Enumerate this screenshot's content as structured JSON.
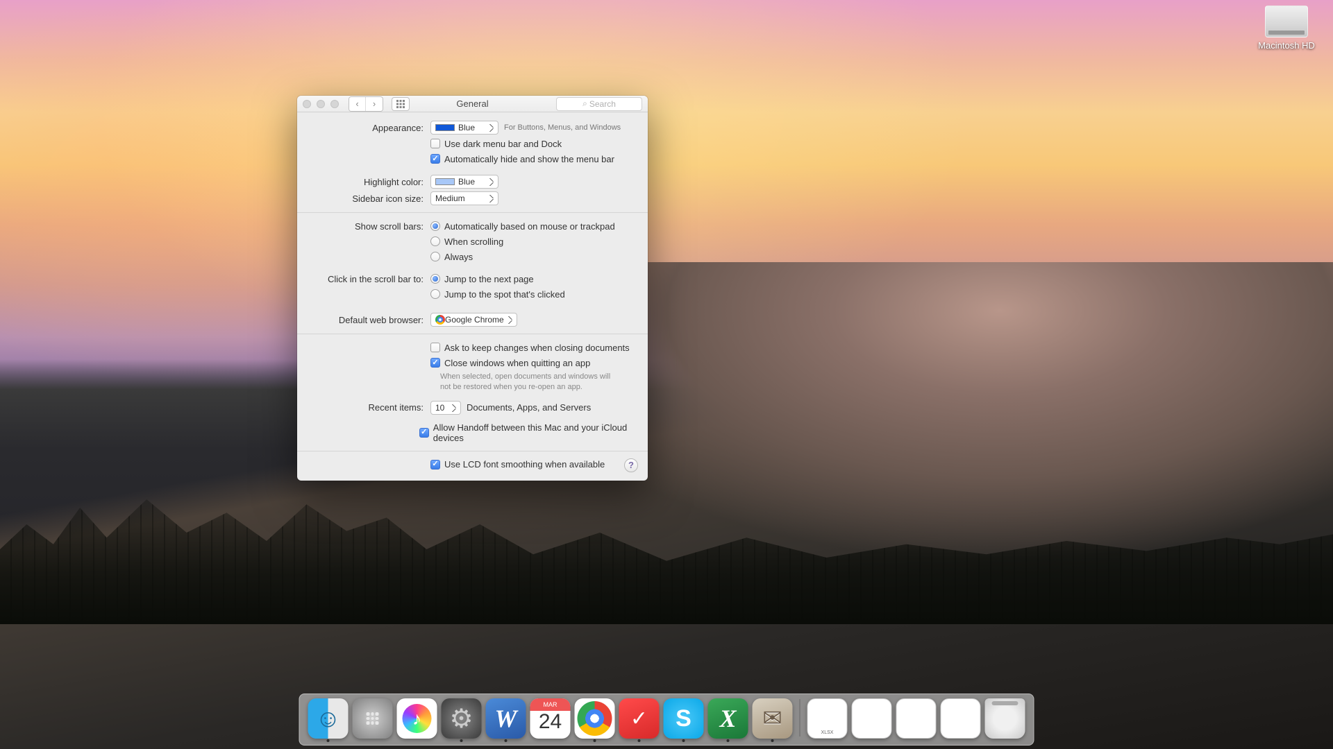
{
  "desktop": {
    "hd_label": "Macintosh HD"
  },
  "window": {
    "title": "General",
    "search_placeholder": "Search"
  },
  "labels": {
    "appearance": "Appearance:",
    "appearance_hint": "For Buttons, Menus, and Windows",
    "highlight": "Highlight color:",
    "sidebar_size": "Sidebar icon size:",
    "scrollbars": "Show scroll bars:",
    "click_scrollbar": "Click in the scroll bar to:",
    "browser": "Default web browser:",
    "recent": "Recent items:",
    "recent_hint": "Documents, Apps, and Servers"
  },
  "values": {
    "appearance": "Blue",
    "highlight": "Blue",
    "sidebar_size": "Medium",
    "browser": "Google Chrome",
    "recent": "10"
  },
  "checkboxes": {
    "dark_menubar": "Use dark menu bar and Dock",
    "autohide_menubar": "Automatically hide and show the menu bar",
    "ask_changes": "Ask to keep changes when closing documents",
    "close_windows": "Close windows when quitting an app",
    "close_windows_hint": "When selected, open documents and windows will not be restored when you re-open an app.",
    "handoff": "Allow Handoff between this Mac and your iCloud devices",
    "lcd": "Use LCD font smoothing when available"
  },
  "radios": {
    "scroll_auto": "Automatically based on mouse or trackpad",
    "scroll_when": "When scrolling",
    "scroll_always": "Always",
    "click_nextpage": "Jump to the next page",
    "click_spot": "Jump to the spot that's clicked"
  },
  "dock": {
    "cal_month": "MAR",
    "cal_day": "24",
    "xlsx": "XLSX"
  }
}
